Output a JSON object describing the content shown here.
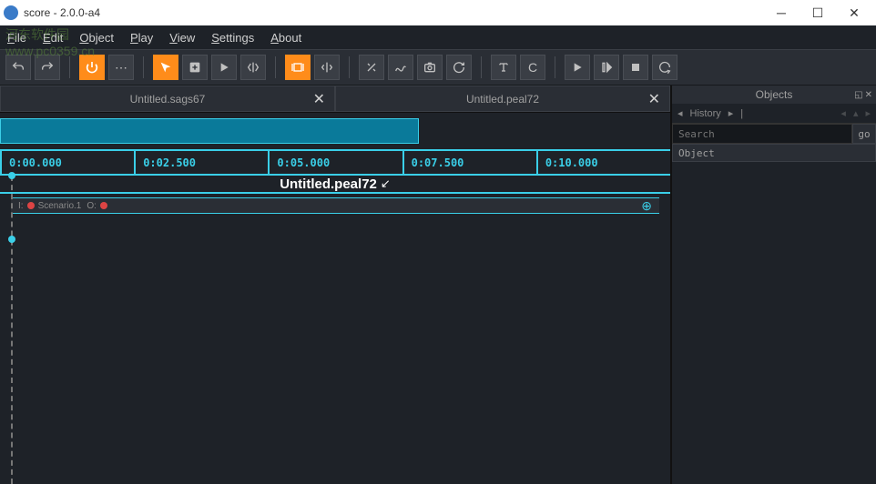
{
  "window": {
    "title": "score - 2.0.0-a4"
  },
  "menu": {
    "file": "File",
    "edit": "Edit",
    "object": "Object",
    "play": "Play",
    "view": "View",
    "settings": "Settings",
    "about": "About"
  },
  "tabs": [
    {
      "label": "Untitled.sags67"
    },
    {
      "label": "Untitled.peal72"
    }
  ],
  "ruler": {
    "t0": "0:00.000",
    "t1": "0:02.500",
    "t2": "0:05.000",
    "t3": "0:07.500",
    "t4": "0:10.000"
  },
  "timeline": {
    "title": "Untitled.peal72",
    "scenario_prefix": "I:",
    "scenario_name": "Scenario.1",
    "scenario_suffix": "O:"
  },
  "panel": {
    "title": "Objects",
    "history_label": "History",
    "search_placeholder": "Search",
    "go_label": "go",
    "list_header": "Object"
  },
  "watermark": {
    "line1": "河东软件园",
    "line2": "www.pc0359.cn"
  }
}
